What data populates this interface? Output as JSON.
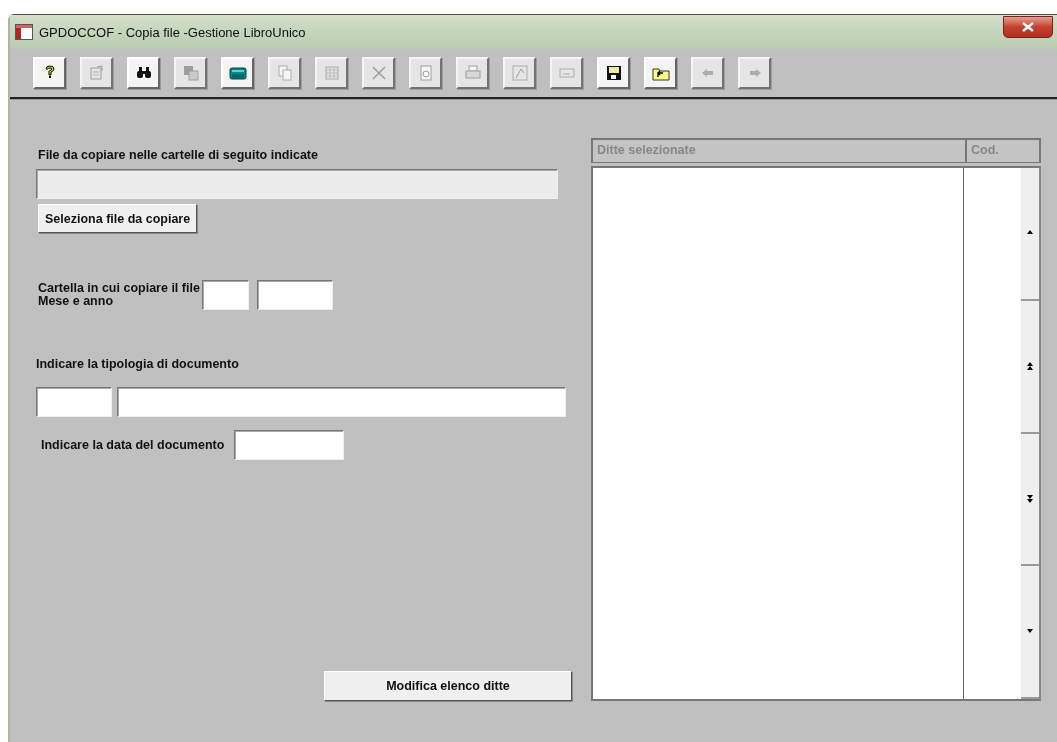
{
  "window": {
    "title": "GPDOCCOF - Copia file -Gestione LibroUnico"
  },
  "toolbar": [
    {
      "kind": "help",
      "disabled": false
    },
    {
      "kind": "properties",
      "disabled": true
    },
    {
      "kind": "find",
      "disabled": false
    },
    {
      "kind": "layers",
      "disabled": true
    },
    {
      "kind": "calculator",
      "disabled": false
    },
    {
      "kind": "copy",
      "disabled": true
    },
    {
      "kind": "grid",
      "disabled": true
    },
    {
      "kind": "delete",
      "disabled": true
    },
    {
      "kind": "preview",
      "disabled": true
    },
    {
      "kind": "print",
      "disabled": true
    },
    {
      "kind": "pen",
      "disabled": true
    },
    {
      "kind": "form",
      "disabled": true
    },
    {
      "kind": "save",
      "disabled": false
    },
    {
      "kind": "folder",
      "disabled": false
    },
    {
      "kind": "back",
      "disabled": true
    },
    {
      "kind": "forward",
      "disabled": true
    }
  ],
  "file_section": {
    "label": "File da copiare nelle cartelle di seguito indicate",
    "field": {
      "disabled": true
    },
    "button": "Seleziona file da copiare"
  },
  "folder_section": {
    "label_lines": [
      "Cartella in cui copiare il file",
      "Mese e anno"
    ],
    "fields": [
      {
        "disabled": false
      },
      {
        "disabled": false
      }
    ]
  },
  "type_section": {
    "label": "Indicare la tipologia di documento",
    "fields": [
      {
        "disabled": false
      },
      {
        "disabled": false
      }
    ]
  },
  "date_section": {
    "label": "Indicare la data del documento",
    "field": {
      "disabled": false
    }
  },
  "modify_button": "Modifica elenco ditte",
  "table": {
    "columns": [
      "Ditte selezionate",
      "Cod."
    ],
    "scroll_buttons": [
      {
        "kind": "up"
      },
      {
        "kind": "page-up"
      },
      {
        "kind": "page-down"
      },
      {
        "kind": "down"
      }
    ]
  }
}
